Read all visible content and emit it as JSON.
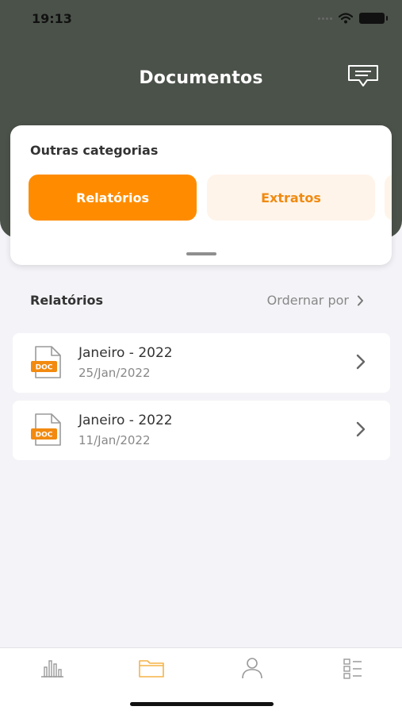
{
  "status_bar": {
    "time": "19:13"
  },
  "header": {
    "title": "Documentos",
    "chat_icon": "chat-bubble-icon"
  },
  "categories_card": {
    "title": "Outras categorias",
    "chips": [
      {
        "label": "Relatórios",
        "selected": true
      },
      {
        "label": "Extratos",
        "selected": false
      }
    ]
  },
  "section": {
    "title": "Relatórios",
    "sort_label": "Ordernar por"
  },
  "documents": [
    {
      "title": "Janeiro - 2022",
      "date": "25/Jan/2022",
      "badge": "DOC"
    },
    {
      "title": "Janeiro - 2022",
      "date": "11/Jan/2022",
      "badge": "DOC"
    }
  ],
  "tabbar": {
    "tabs": [
      {
        "icon": "bar-chart-icon",
        "active": false
      },
      {
        "icon": "folder-icon",
        "active": true
      },
      {
        "icon": "user-icon",
        "active": false
      },
      {
        "icon": "list-icon",
        "active": false
      }
    ]
  },
  "colors": {
    "header_bg": "#4b524a",
    "accent": "#ff8c00",
    "chip_inactive_bg": "#fff4ea",
    "page_bg": "#f4f4f8"
  }
}
